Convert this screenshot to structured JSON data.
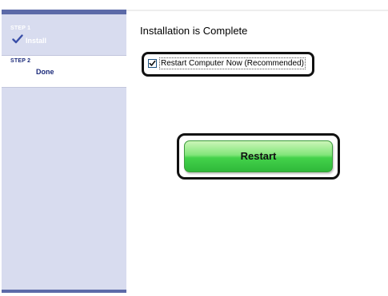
{
  "sidebar": {
    "steps": [
      {
        "heading": "STEP 1",
        "label": "Install",
        "state": "completed"
      },
      {
        "heading": "STEP 2",
        "label": "Done",
        "state": "current"
      }
    ]
  },
  "main": {
    "title": "Installation is Complete",
    "restart_checkbox": {
      "label": "Restart Computer Now (Recommended)",
      "checked": true
    },
    "restart_button_label": "Restart"
  },
  "icons": {
    "step_complete": "checkmark-icon",
    "checkbox_mark": "checkmark-icon"
  },
  "colors": {
    "sidebar_background": "#d8dcef",
    "sidebar_accent": "#5c6aa8",
    "step_text": "#1b2a7a",
    "button_green": "#43d24a"
  }
}
